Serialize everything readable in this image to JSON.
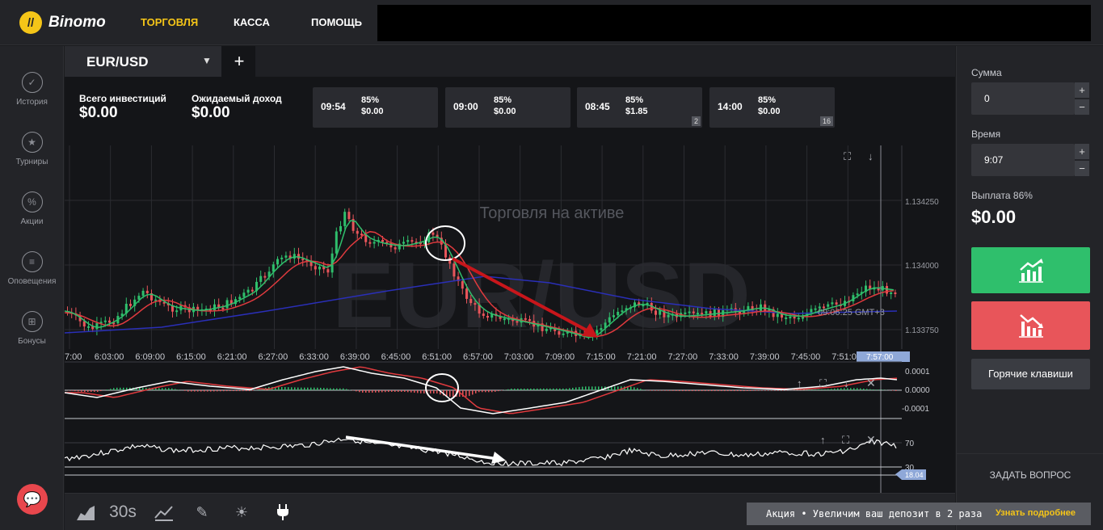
{
  "header": {
    "logo_text": "Binomo",
    "nav": [
      "ТОРГОВЛЯ",
      "КАССА",
      "ПОМОЩЬ"
    ]
  },
  "sidebar": {
    "items": [
      {
        "label": "История",
        "icon": "check-circle-icon"
      },
      {
        "label": "Турниры",
        "icon": "trophy-icon"
      },
      {
        "label": "Акции",
        "icon": "percent-icon"
      },
      {
        "label": "Оповещения",
        "icon": "list-icon"
      },
      {
        "label": "Бонусы",
        "icon": "gift-icon"
      }
    ]
  },
  "asset": {
    "name": "EUR/USD"
  },
  "investments": {
    "total_label": "Всего инвестиций",
    "total_value": "$0.00",
    "expected_label": "Ожидаемый доход",
    "expected_value": "$0.00"
  },
  "deals": [
    {
      "time": "09:54",
      "pct": "85%",
      "amount": "$0.00",
      "badge": ""
    },
    {
      "time": "09:00",
      "pct": "85%",
      "amount": "$0.00",
      "badge": ""
    },
    {
      "time": "08:45",
      "pct": "85%",
      "amount": "$1.85",
      "badge": "2"
    },
    {
      "time": "14:00",
      "pct": "85%",
      "amount": "$0.00",
      "badge": "16"
    }
  ],
  "chart": {
    "watermark_caption": "Торговля на активе",
    "watermark_symbol": "EUR/USD",
    "price_ticks": [
      "1.134250",
      "1.134000",
      "1.133750"
    ],
    "time_ticks": [
      "7:00",
      "6:03:00",
      "6:09:00",
      "6:15:00",
      "6:21:00",
      "6:27:00",
      "6:33:00",
      "6:39:00",
      "6:45:00",
      "6:51:00",
      "6:57:00",
      "7:03:00",
      "7:09:00",
      "7:15:00",
      "7:21:00",
      "7:27:00",
      "7:33:00",
      "7:39:00",
      "7:45:00",
      "7:51:00"
    ],
    "current_time": "7:57:00",
    "server_time": "09:06:25 GMT+3",
    "macd_ticks": [
      "0.0001",
      "0.0000",
      "-0.0001"
    ],
    "rsi_ticks": [
      "70",
      "30"
    ],
    "rsi_value": "18.04"
  },
  "trade_panel": {
    "sum_label": "Сумма",
    "sum_value": "0",
    "time_label": "Время",
    "time_value": "9:07",
    "payout_label": "Выплата 86%",
    "payout_value": "$0.00",
    "hotkeys_label": "Горячие клавиши",
    "ask_label": "ЗАДАТЬ ВОПРОС"
  },
  "toolbar": {
    "timeframe_label": "30s"
  },
  "promo": {
    "text": "Акция • Увеличим ваш депозит в 2 раза",
    "link": "Узнать подробнее"
  },
  "colors": {
    "accent": "#f5c518",
    "up": "#2fbf6c",
    "down": "#e8555a",
    "candle_up": "#2fbf6c",
    "candle_down": "#e8555a",
    "ma_fast": "#2fbf6c",
    "ma_mid": "#e03a3e",
    "ma_slow": "#2a2fb8"
  }
}
